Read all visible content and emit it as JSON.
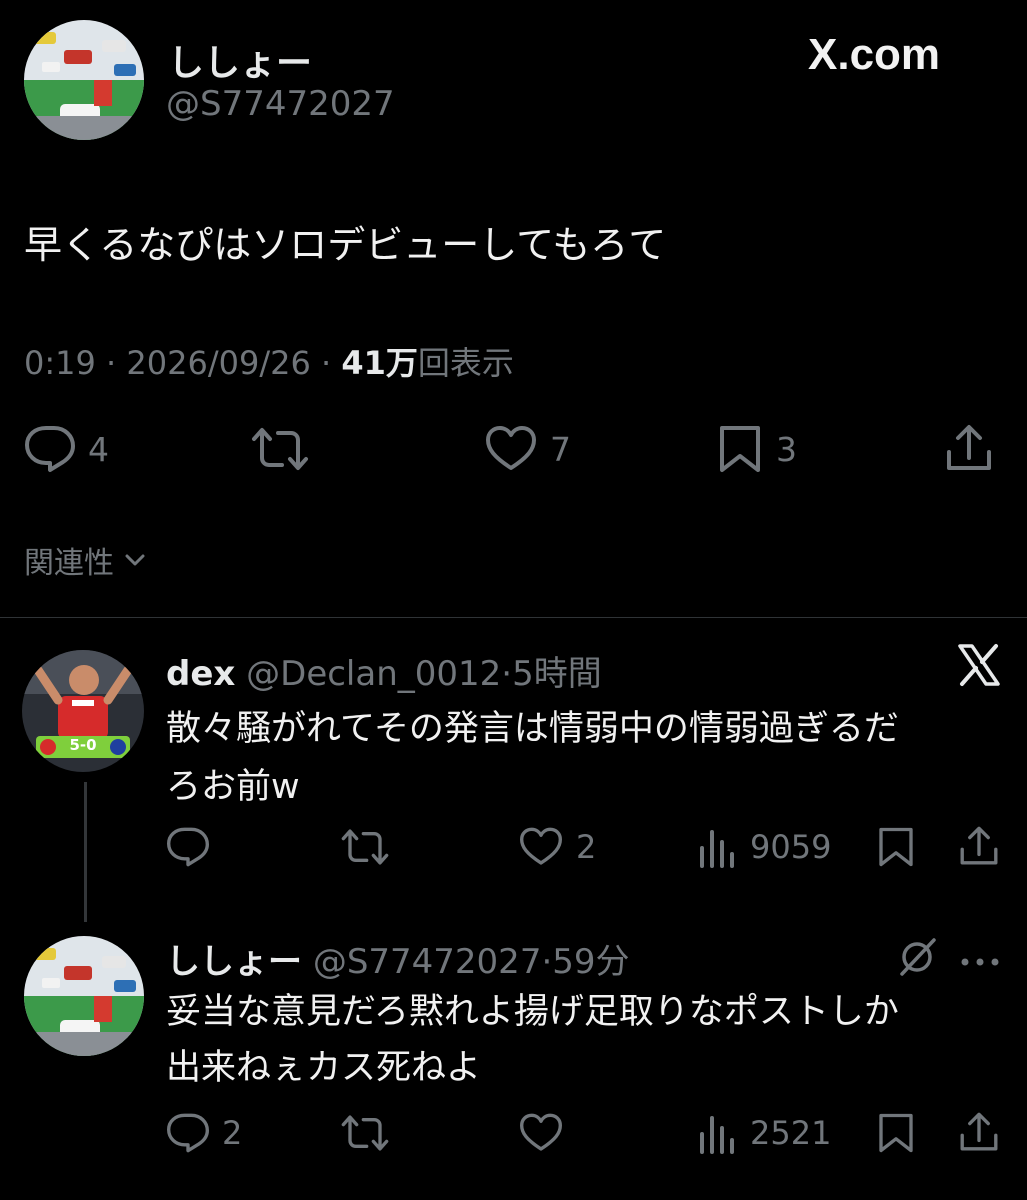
{
  "brand": {
    "label": "X.com"
  },
  "main_tweet": {
    "display_name": "ししょー",
    "handle": "@S77472027",
    "text": "早くるなぴはソロデビューしてもろて",
    "time": "0:19",
    "date": "2026/09/26",
    "views_count": "41万",
    "views_label": "回表示",
    "separator": "·",
    "actions": {
      "replies": "4",
      "likes": "7",
      "bookmarks": "3"
    }
  },
  "sort": {
    "label": "関連性"
  },
  "replies": [
    {
      "display_name": "dex",
      "handle": "@Declan_0012",
      "separator": "·",
      "time": "5時間",
      "text_line1": "散々騒がれてその発言は情弱中の情弱過ぎるだ",
      "text_line2": "ろお前w",
      "badge_icon": "x-logo-icon",
      "avatar_score": "5-0",
      "actions": {
        "likes": "2",
        "views": "9059"
      }
    },
    {
      "display_name": "ししょー",
      "handle": "@S77472027",
      "separator": "·",
      "time": "59分",
      "text_line1": "妥当な意見だろ黙れよ揚げ足取りなポストしか",
      "text_line2": "出来ねぇカス死ねよ",
      "badge_icon": "grok-icon",
      "actions": {
        "replies": "2",
        "views": "2521"
      }
    }
  ],
  "colors": {
    "background": "#000000",
    "text": "#e7e9ea",
    "muted": "#71767b"
  }
}
